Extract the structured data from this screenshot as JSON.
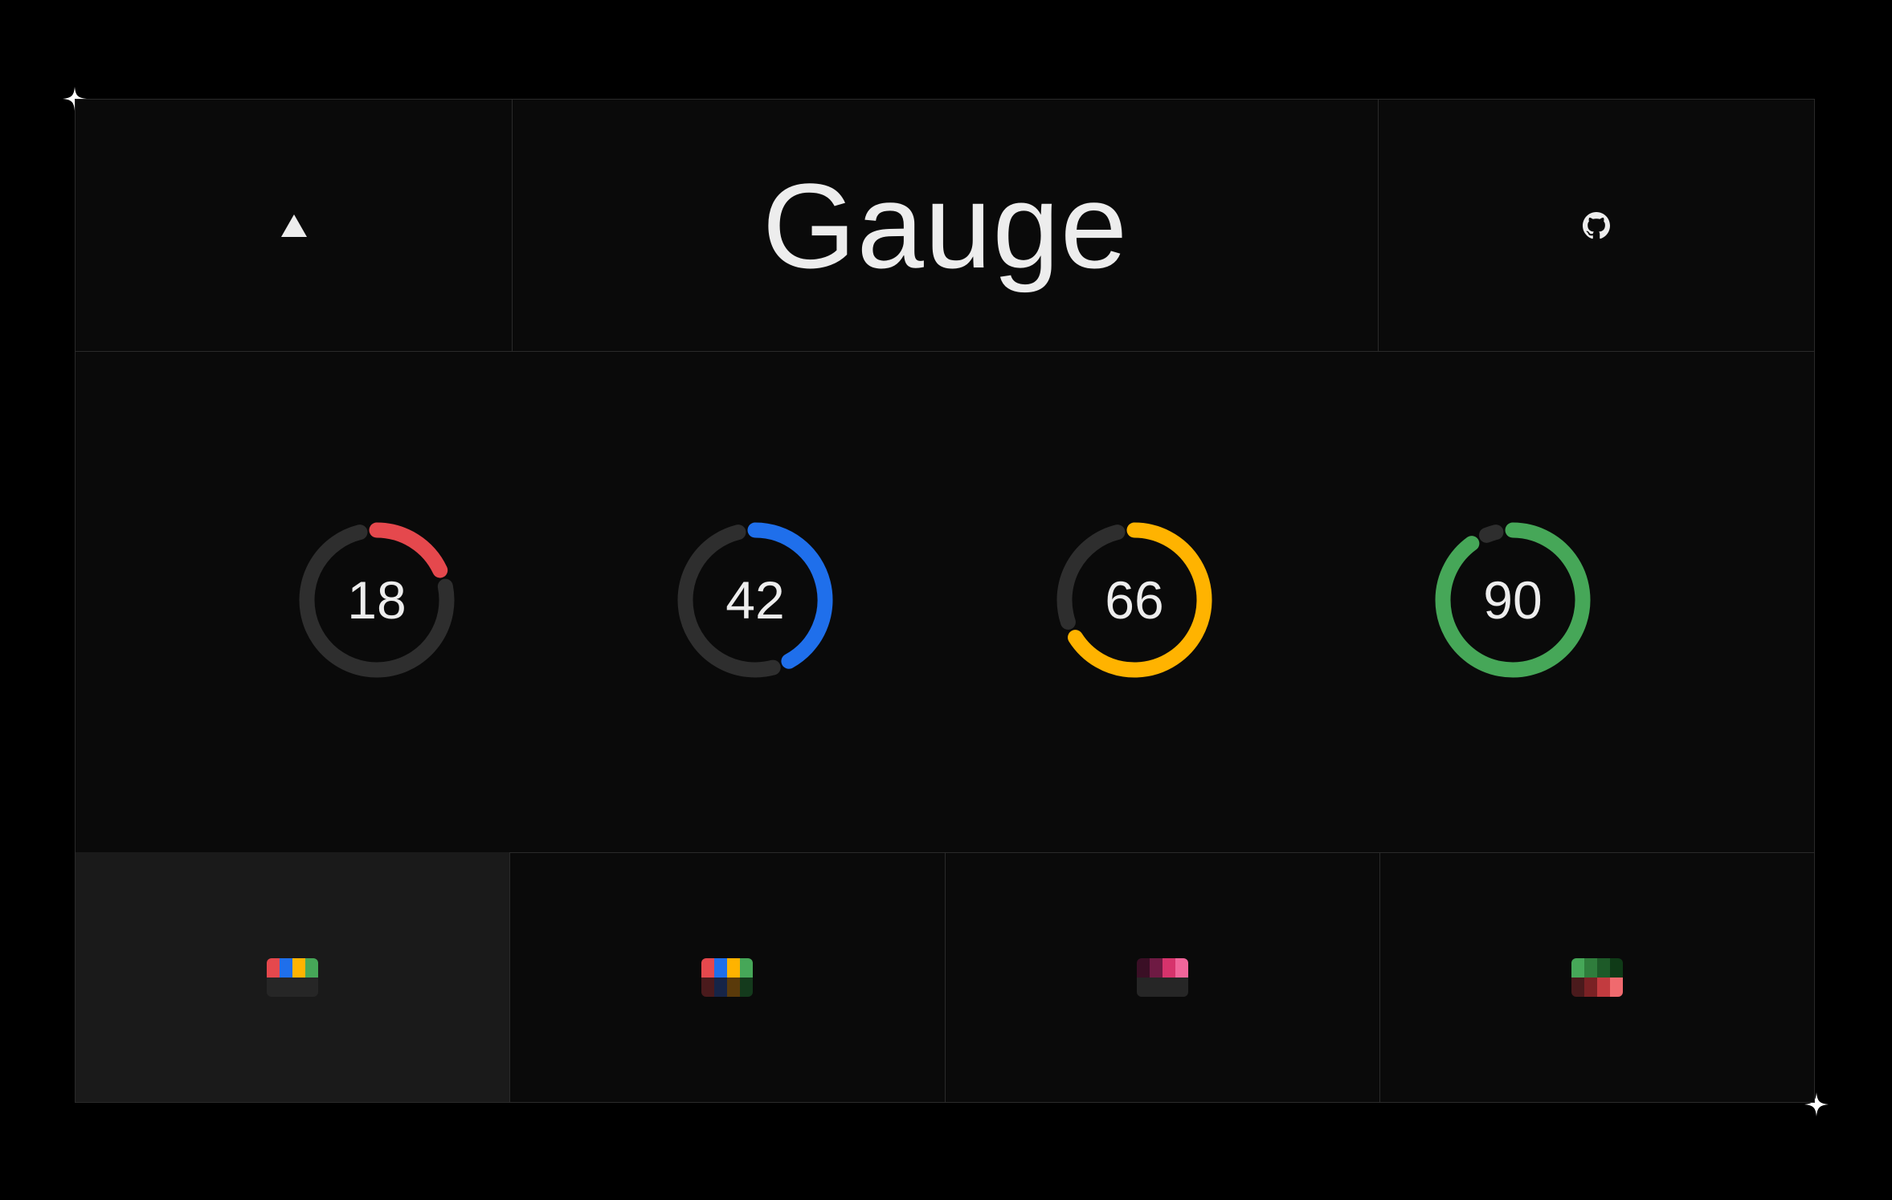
{
  "header": {
    "title": "Gauge",
    "logo_icon": "vercel-triangle-icon",
    "github_icon": "github-icon"
  },
  "gauges": [
    {
      "value": "18",
      "percent": 18,
      "color": "#e5484d"
    },
    {
      "value": "42",
      "percent": 42,
      "color": "#1f6feb"
    },
    {
      "value": "66",
      "percent": 66,
      "color": "#ffb300"
    },
    {
      "value": "90",
      "percent": 90,
      "color": "#46a758"
    }
  ],
  "colors": {
    "track": "#2e2e2e",
    "background": "#0a0a0a",
    "border": "#2a2a2a",
    "text": "#ededed"
  },
  "palettes": [
    {
      "selected": true,
      "cells": [
        "#e5484d",
        "#1f6feb",
        "#ffb300",
        "#46a758",
        "#262626",
        "#262626",
        "#262626",
        "#262626"
      ]
    },
    {
      "selected": false,
      "cells": [
        "#e5484d",
        "#1f6feb",
        "#ffb300",
        "#46a758",
        "#4a1a1c",
        "#162447",
        "#5a3a0a",
        "#143a1c"
      ]
    },
    {
      "selected": false,
      "cells": [
        "#3a0f25",
        "#6e1a43",
        "#d6336c",
        "#f0659a",
        "#262626",
        "#262626",
        "#262626",
        "#262626"
      ]
    },
    {
      "selected": false,
      "cells": [
        "#46a758",
        "#2f7d3c",
        "#1d5a28",
        "#0f3a17",
        "#4a1a1c",
        "#7a2124",
        "#c23b3f",
        "#f06a6e"
      ]
    }
  ]
}
